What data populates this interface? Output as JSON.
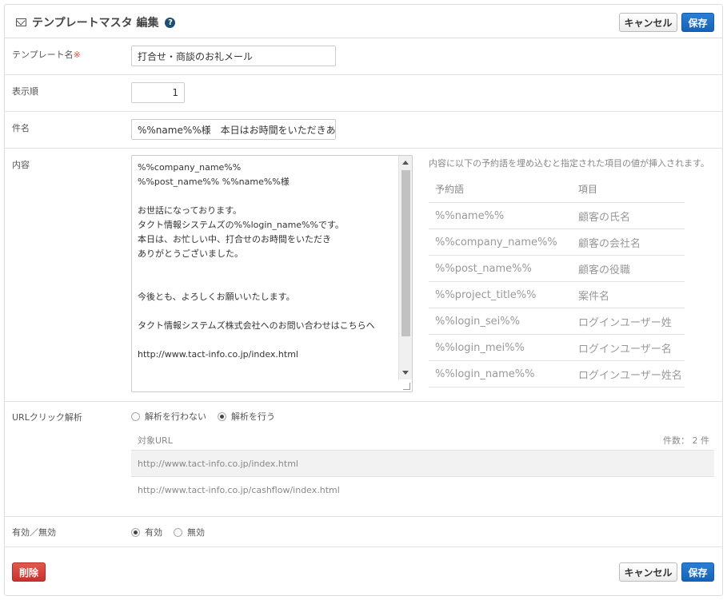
{
  "header": {
    "title": "テンプレートマスタ 編集",
    "help": "?",
    "cancel_label": "キャンセル",
    "save_label": "保存"
  },
  "form": {
    "template_name_label": "テンプレート名",
    "required_mark": "※",
    "template_name_value": "打合せ・商談のお礼メール",
    "order_label": "表示順",
    "order_value": "1",
    "subject_label": "件名",
    "subject_value": "%%name%%様　本日はお時間をいただきありがとうございました",
    "content_label": "内容",
    "content_value": "%%company_name%%\n%%post_name%% %%name%%様\n\nお世話になっております。\nタクト情報システムズの%%login_name%%です。\n本日は、お忙しい中、打合せのお時間をいただき\nありがとうございました。\n\n\n今後とも、よろしくお願いいたします。\n\nタクト情報システムズ株式会社へのお問い合わせはこちらへ\n\nhttp://www.tact-info.co.jp/index.html\n\n\n",
    "url_label": "URLクリック解析",
    "url_options": [
      "解析を行わない",
      "解析を行う"
    ],
    "url_selected": "解析を行う",
    "enabled_label": "有効／無効",
    "enabled_options": [
      "有効",
      "無効"
    ],
    "enabled_selected": "有効"
  },
  "reserved": {
    "hint": "内容に以下の予約語を埋め込むと指定された項目の値が挿入されます。",
    "headers": [
      "予約語",
      "項目"
    ],
    "rows": [
      [
        "%%name%%",
        "顧客の氏名"
      ],
      [
        "%%company_name%%",
        "顧客の会社名"
      ],
      [
        "%%post_name%%",
        "顧客の役職"
      ],
      [
        "%%project_title%%",
        "案件名"
      ],
      [
        "%%login_sei%%",
        "ログインユーザー姓"
      ],
      [
        "%%login_mei%%",
        "ログインユーザー名"
      ],
      [
        "%%login_name%%",
        "ログインユーザー姓名"
      ]
    ]
  },
  "urls": {
    "header": "対象URL",
    "count": "件数： 2 件",
    "items": [
      "http://www.tact-info.co.jp/index.html",
      "http://www.tact-info.co.jp/cashflow/index.html"
    ]
  },
  "footer": {
    "delete_label": "削除",
    "cancel_label": "キャンセル",
    "save_label": "保存"
  },
  "colors": {
    "primary": "#1563b8",
    "danger": "#c9302c",
    "required": "#e74c3c"
  }
}
